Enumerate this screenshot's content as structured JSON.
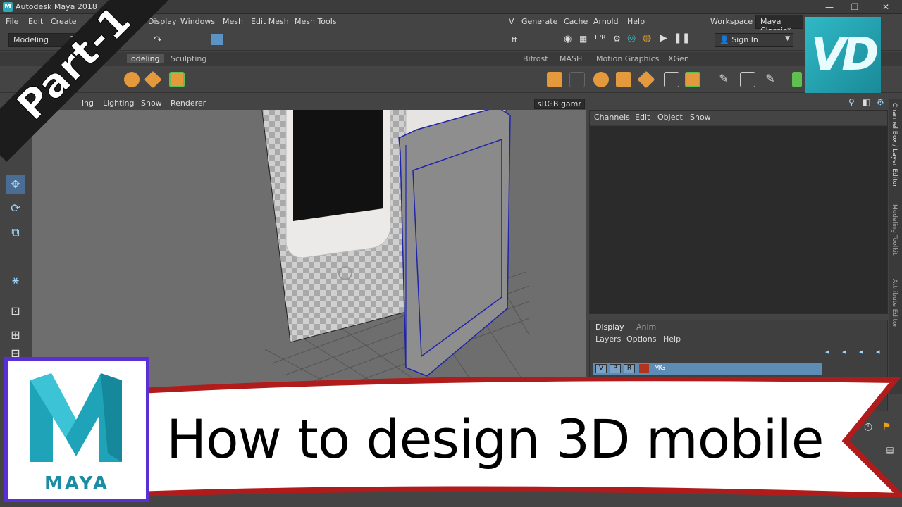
{
  "titlebar": {
    "title": "Autodesk Maya 2018",
    "app_icon": "M"
  },
  "menubar": {
    "items": [
      "File",
      "Edit",
      "Create",
      "Display",
      "Windows",
      "Mesh",
      "Edit Mesh",
      "Mesh Tools",
      "V",
      "Generate",
      "Cache",
      "Arnold",
      "Help"
    ]
  },
  "statusline": {
    "mode_dropdown": "Modeling",
    "workspace_label": "Workspace :",
    "workspace_value": "Maya Classic*",
    "sign_in": "Sign In",
    "off_label": "ff"
  },
  "shelf": {
    "tabs": [
      "odeling",
      "Sculpting",
      "Bifrost",
      "MASH",
      "Motion Graphics",
      "XGen"
    ]
  },
  "viewport": {
    "menu": [
      "ing",
      "Lighting",
      "Show",
      "Renderer"
    ],
    "color_space": "sRGB gamr"
  },
  "channelbox": {
    "menu": [
      "Channels",
      "Edit",
      "Object",
      "Show"
    ]
  },
  "side_tabs": [
    "Channel Box / Layer Editor",
    "Modeling Toolkit",
    "Attribute Editor"
  ],
  "layereditor": {
    "tabs": [
      "Display",
      "Anim"
    ],
    "menu": [
      "Layers",
      "Options",
      "Help"
    ],
    "layer": {
      "v": "V",
      "p": "P",
      "r": "R",
      "name": "IMG",
      "color": "#b0341e"
    }
  },
  "overlay": {
    "part_label": "Part-1",
    "vd_logo": "VD",
    "maya_logo_label": "MAYA",
    "headline": "How to design 3D mobile"
  },
  "colors": {
    "accent_teal": "#2fa8b8",
    "ribbon_red": "#b01c1c",
    "maya_border": "#5b2fd6",
    "layer_blue": "#5d8cb5"
  }
}
